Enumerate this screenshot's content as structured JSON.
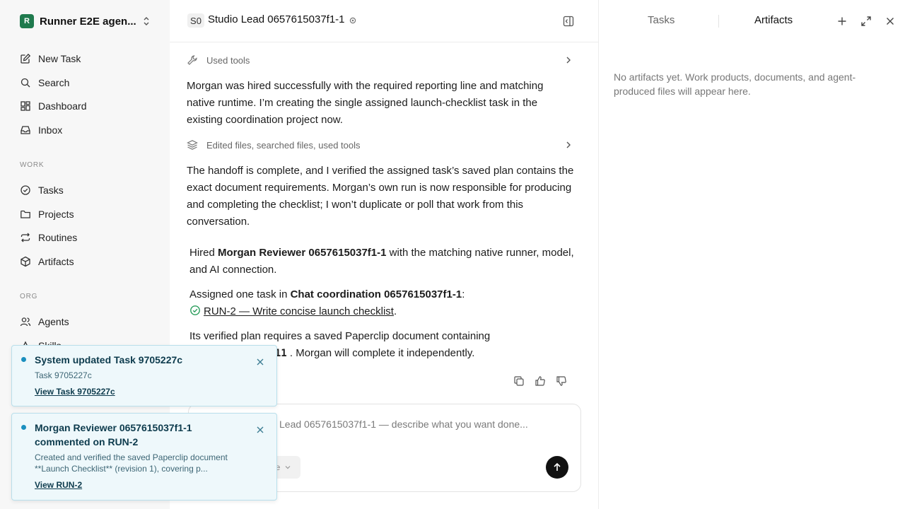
{
  "sidebar": {
    "workspace_logo": "R",
    "workspace_name": "Runner E2E agen...",
    "nav": [
      {
        "label": "New Task",
        "icon": "edit-icon"
      },
      {
        "label": "Search",
        "icon": "search-icon"
      },
      {
        "label": "Dashboard",
        "icon": "dashboard-icon"
      },
      {
        "label": "Inbox",
        "icon": "inbox-icon"
      }
    ],
    "work_heading": "WORK",
    "work": [
      {
        "label": "Tasks",
        "icon": "check-circle-icon"
      },
      {
        "label": "Projects",
        "icon": "folder-icon"
      },
      {
        "label": "Routines",
        "icon": "repeat-icon"
      },
      {
        "label": "Artifacts",
        "icon": "cube-icon"
      }
    ],
    "org_heading": "ORG",
    "org": [
      {
        "label": "Agents",
        "icon": "users-icon"
      },
      {
        "label": "Skills",
        "icon": "skills-icon"
      }
    ]
  },
  "main": {
    "badge": "S0",
    "title": "Studio Lead 0657615037f1-1",
    "tools_row_1": "Used tools",
    "para_1": "Morgan was hired successfully with the required reporting line and matching native runtime. I’m creating the single assigned launch-checklist task in the existing coordination project now.",
    "tools_row_2": "Edited files, searched files, used tools",
    "para_2": "The handoff is complete, and I verified the assigned task’s saved plan contains the exact document requirements. Morgan’s own run is now responsible for producing and completing the checklist; I won’t duplicate or poll that work from this conversation.",
    "summary": {
      "hired_prefix": "Hired ",
      "hired_name": "Morgan Reviewer 0657615037f1-1",
      "hired_suffix": " with the matching native runner, model, and AI connection.",
      "assigned_prefix": "Assigned one task in ",
      "assigned_project": "Chat coordination 0657615037f1-1",
      "assigned_suffix": ":",
      "task_link": "RUN-2 — Write concise launch checklist",
      "task_link_suffix": ".",
      "plan_text": "Its verified plan requires a saved Paperclip document containing",
      "plan_code": "7f11",
      "plan_suffix": " . Morgan will complete it independently."
    },
    "composer": {
      "placeholder": "Lead 0657615037f1-1 — describe what you want done...",
      "chip": "e"
    }
  },
  "right_panel": {
    "tab_tasks": "Tasks",
    "tab_artifacts": "Artifacts",
    "empty_text": "No artifacts yet. Work products, documents, and agent-produced files will appear here."
  },
  "toasts": [
    {
      "title": "System updated Task 9705227c",
      "body": "Task 9705227c",
      "link": "View Task 9705227c"
    },
    {
      "title_line1": "Morgan Reviewer 0657615037f1-1",
      "title_line2": "commented on RUN-2",
      "body_line1": "Created and verified the saved Paperclip document",
      "body_line2": "**Launch Checklist** (revision 1), covering p...",
      "link": "View RUN-2"
    }
  ]
}
